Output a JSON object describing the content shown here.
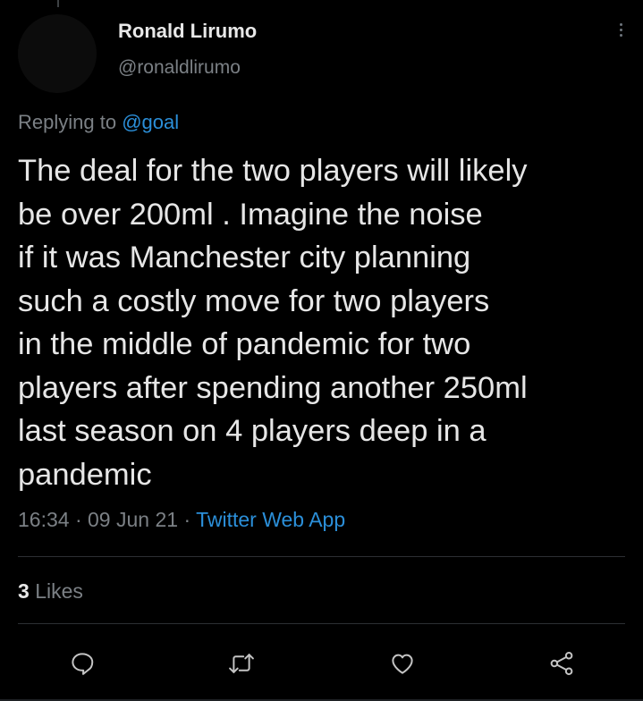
{
  "tweet": {
    "author_name": "Ronald Lirumo",
    "author_handle": "@ronaldlirumo",
    "replying_prefix": "Replying to",
    "replying_to": "@goal",
    "text": "The deal for the two players will likely\nbe over 200ml . Imagine the noise\nif it was Manchester city planning\nsuch a costly move for two players\nin the middle of pandemic for two\nplayers after spending another 250ml\nlast season on 4 players deep in a\npandemic",
    "time": "16:34",
    "separator": "·",
    "date": "09 Jun 21",
    "source": "Twitter Web App",
    "likes_count": "3",
    "likes_label": "Likes"
  },
  "icons": {
    "more": "more-vertical-icon",
    "reply": "reply-icon",
    "retweet": "retweet-icon",
    "like": "heart-icon",
    "share": "share-icon"
  },
  "colors": {
    "background": "#000000",
    "link": "#2b8fd9",
    "muted": "#7b8085",
    "text": "#e6e6e6"
  }
}
